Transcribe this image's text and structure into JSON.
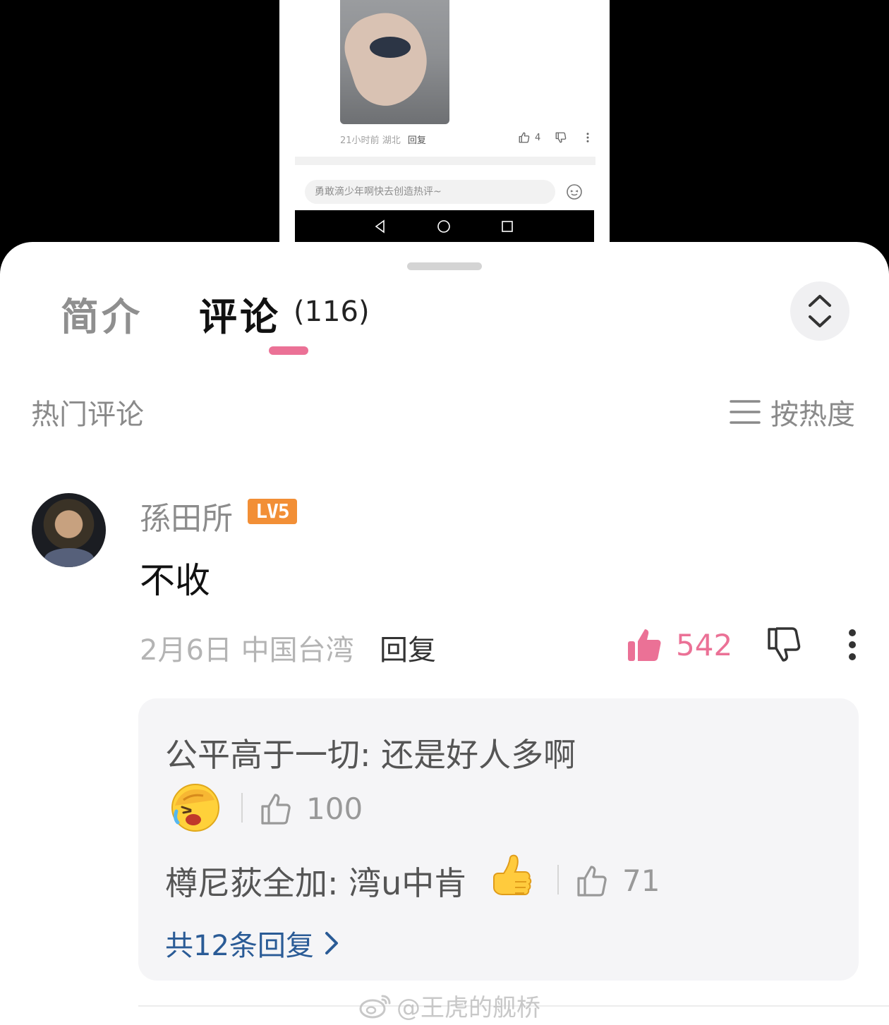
{
  "video": {
    "meta_time": "21小时前",
    "meta_location": "湖北",
    "meta_reply": "回复",
    "like_count": "4",
    "input_placeholder": "勇敢滴少年啊快去创造热评~"
  },
  "tabs": {
    "intro": "简介",
    "comments": "评论",
    "comment_count": "(116)"
  },
  "section": {
    "title": "热门评论",
    "sort_label": "按热度"
  },
  "comment": {
    "username": "孫田所",
    "level": "LV5",
    "text": "不收",
    "date": "2月6日",
    "location": "中国台湾",
    "reply_label": "回复",
    "likes": "542"
  },
  "replies": {
    "items": [
      {
        "text": "公平高于一切: 还是好人多啊",
        "likes": "100",
        "emoji": "laughing-crying-emoji"
      },
      {
        "text": "樽尼荻全加: 湾u中肯",
        "likes": "71",
        "emoji": "thumbs-up-emoji"
      }
    ],
    "view_all": "共12条回复"
  },
  "watermark": "@王虎的舰桥",
  "colors": {
    "accent_pink": "#eb7196",
    "link_blue": "#2a5b96",
    "level_badge": "#f28f36"
  }
}
